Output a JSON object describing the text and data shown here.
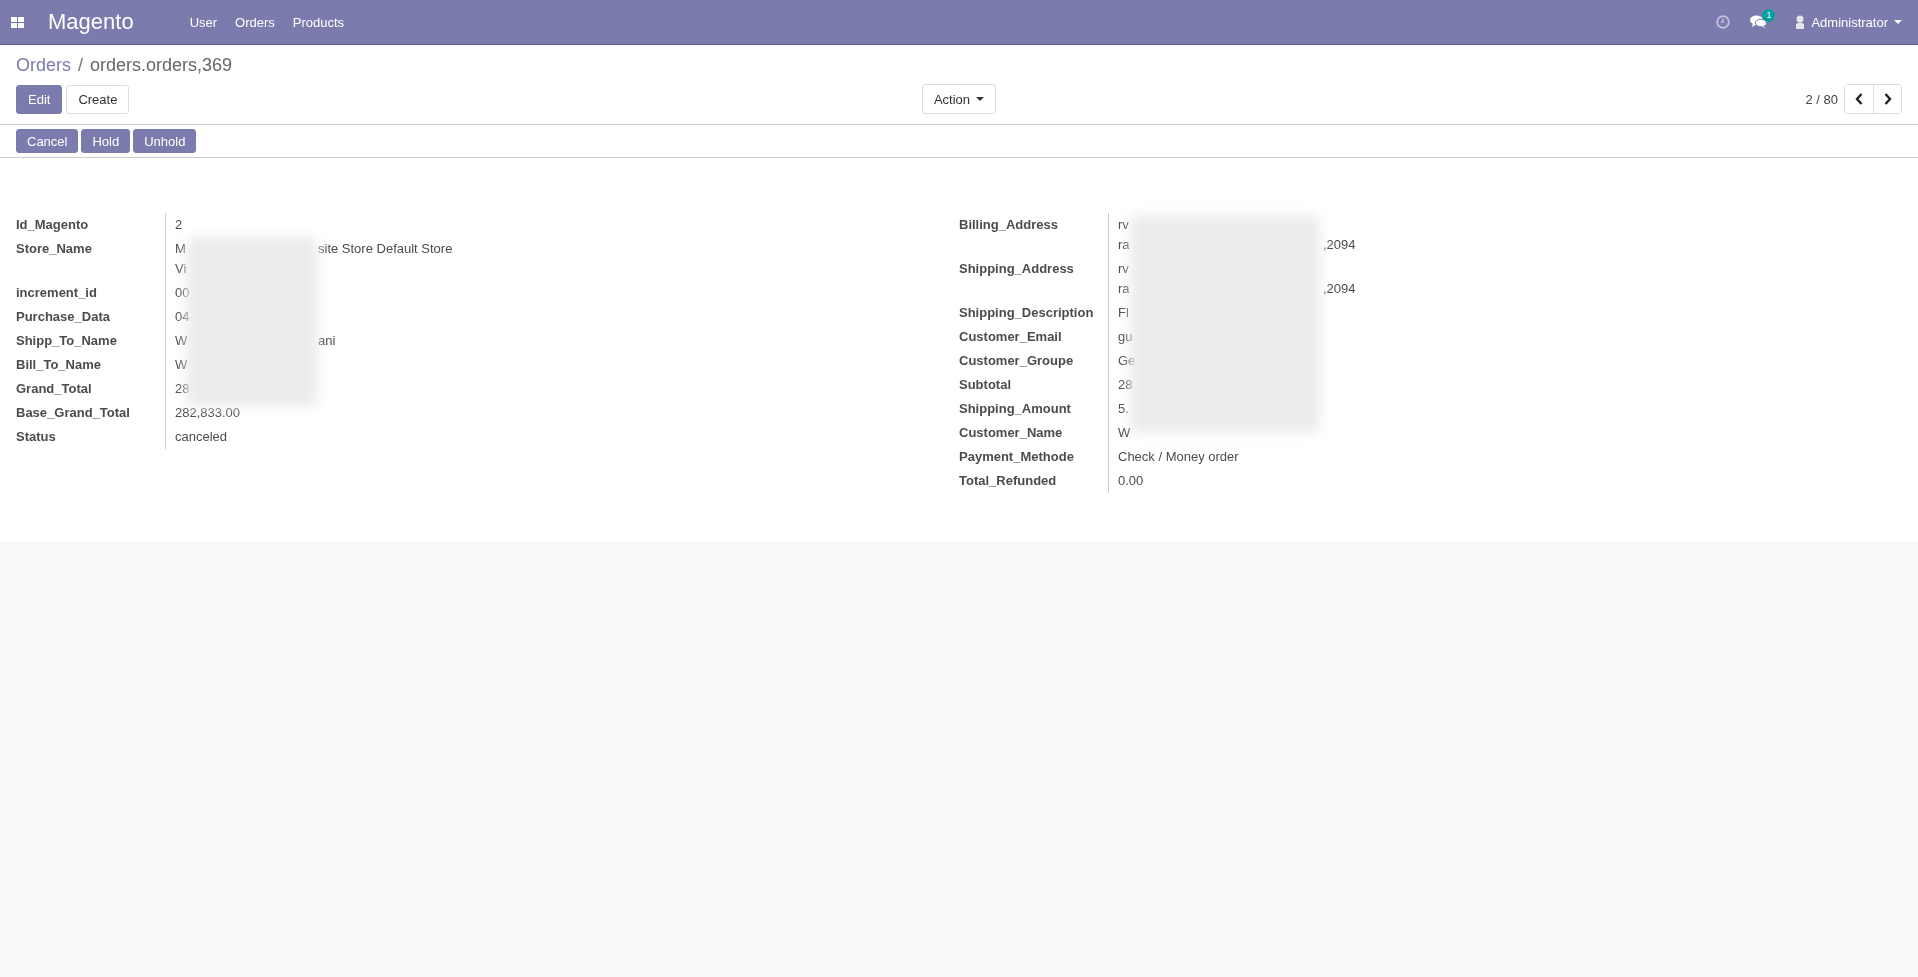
{
  "navbar": {
    "brand": "Magento",
    "menu": [
      "User",
      "Orders",
      "Products"
    ],
    "messages_badge": "1",
    "user": "Administrator"
  },
  "breadcrumb": {
    "parent": "Orders",
    "separator": "/",
    "current": "orders.orders,369"
  },
  "buttons": [
    "Edit",
    "Create"
  ],
  "action": "Action",
  "pager": "2 / 80",
  "status_buttons": [
    "Cancel",
    "Hold",
    "Unhold"
  ],
  "left_fields": [
    {
      "label": "Id_Magento",
      "lines": [
        {
          "start": "2"
        }
      ]
    },
    {
      "label": "Store_Name",
      "lines": [
        {
          "start": "M",
          "end": "site Store Default Store"
        },
        {
          "start": "Vi"
        }
      ]
    },
    {
      "label": "increment_id",
      "lines": [
        {
          "start": "00"
        }
      ]
    },
    {
      "label": "Purchase_Data",
      "lines": [
        {
          "start": "04"
        }
      ]
    },
    {
      "label": "Shipp_To_Name",
      "lines": [
        {
          "start": "W",
          "end": "ani"
        }
      ]
    },
    {
      "label": "Bill_To_Name",
      "lines": [
        {
          "start": "W"
        }
      ]
    },
    {
      "label": "Grand_Total",
      "lines": [
        {
          "start": "28"
        }
      ]
    },
    {
      "label": "Base_Grand_Total",
      "lines": [
        {
          "start": "282,833.00"
        }
      ]
    },
    {
      "label": "Status",
      "lines": [
        {
          "start": "canceled"
        }
      ]
    }
  ],
  "right_fields": [
    {
      "label": "Billing_Address",
      "lines": [
        {
          "start": "rv"
        },
        {
          "start": "ra",
          "end": ",2094"
        }
      ]
    },
    {
      "label": "Shipping_Address",
      "lines": [
        {
          "start": "rv"
        },
        {
          "start": "ra",
          "end": ",2094"
        }
      ]
    },
    {
      "label": "Shipping_Description",
      "lines": [
        {
          "start": "Fl"
        }
      ]
    },
    {
      "label": "Customer_Email",
      "lines": [
        {
          "start": "gu"
        }
      ]
    },
    {
      "label": "Customer_Groupe",
      "lines": [
        {
          "start": "Ge"
        }
      ]
    },
    {
      "label": "Subtotal",
      "lines": [
        {
          "start": "28"
        }
      ]
    },
    {
      "label": "Shipping_Amount",
      "lines": [
        {
          "start": "5."
        }
      ]
    },
    {
      "label": "Customer_Name",
      "lines": [
        {
          "start": "W"
        }
      ]
    },
    {
      "label": "Payment_Methode",
      "lines": [
        {
          "start": "Check / Money order"
        }
      ]
    },
    {
      "label": "Total_Refunded",
      "lines": [
        {
          "start": "0.00"
        }
      ]
    }
  ]
}
